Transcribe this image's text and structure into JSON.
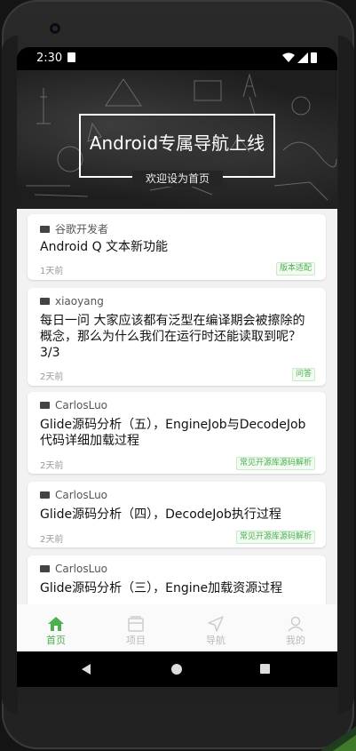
{
  "status": {
    "time": "2:30"
  },
  "hero": {
    "title": "Android专属导航上线",
    "subtitle": "欢迎设为首页"
  },
  "articles": [
    {
      "author": "谷歌开发者",
      "title": "Android Q 文本新功能",
      "time": "1天前",
      "tag": "版本适配"
    },
    {
      "author": "xiaoyang",
      "title": "每日一问 大家应该都有泛型在编译期会被擦除的概念，那么为什么我们在运行时还能读取到呢？ 3/3",
      "time": "2天前",
      "tag": "问答"
    },
    {
      "author": "CarlosLuo",
      "title": "Glide源码分析（五），EngineJob与DecodeJob代码详细加载过程",
      "time": "2天前",
      "tag": "常见开源库源码解析"
    },
    {
      "author": "CarlosLuo",
      "title": "Glide源码分析（四），DecodeJob执行过程",
      "time": "2天前",
      "tag": "常见开源库源码解析"
    },
    {
      "author": "CarlosLuo",
      "title": "Glide源码分析（三），Engine加载资源过程"
    }
  ],
  "nav": [
    {
      "label": "首页",
      "icon": "home-icon"
    },
    {
      "label": "项目",
      "icon": "project-icon"
    },
    {
      "label": "导航",
      "icon": "navigation-icon"
    },
    {
      "label": "我的",
      "icon": "profile-icon"
    }
  ],
  "colors": {
    "accent": "#4caf50",
    "heroBg": "#1e1e1e",
    "feedBg": "#f2f2f2"
  }
}
